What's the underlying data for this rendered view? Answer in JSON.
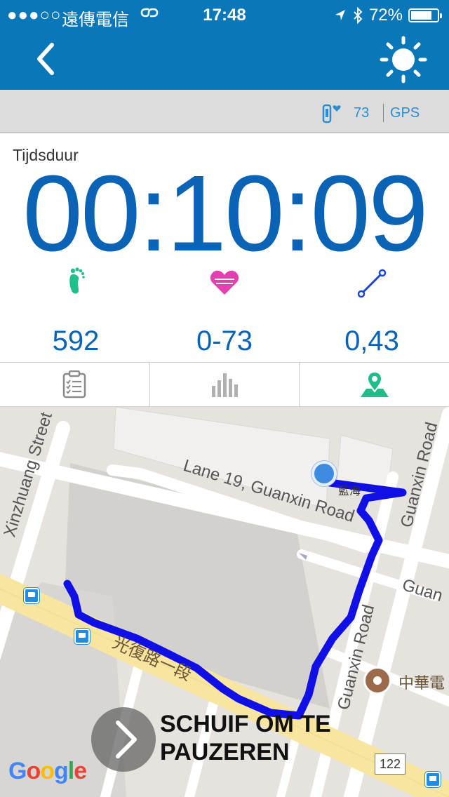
{
  "status_bar": {
    "signal": "●●●○○",
    "carrier": "遠傳電信",
    "time": "17:48",
    "battery": "72%",
    "battery_level": 0.72
  },
  "nav": {
    "back_icon": "chevron-left-icon",
    "brightness_icon": "sun-icon"
  },
  "device_bar": {
    "heart_rate": "73",
    "gps": "GPS"
  },
  "workout": {
    "duration_label": "Tijdsduur",
    "duration": "00:10:09",
    "steps": "592",
    "heart_range": "0-73",
    "distance": "0,43"
  },
  "tabs": [
    {
      "icon": "clipboard-checklist-icon",
      "active": false
    },
    {
      "icon": "bar-chart-icon",
      "active": false
    },
    {
      "icon": "map-pin-icon",
      "active": true
    }
  ],
  "map": {
    "labels": {
      "xinzhuang": "Xinzhuang Street",
      "lane19": "Lane 19, Guanxin Road",
      "guanxin_top": "Guanxin Road",
      "guanxin_mid": "Guan",
      "guanxin_road": "Guanxin Road",
      "guangfu": "光復路一段",
      "lanhai": "藍海",
      "zhonghua": "中華電"
    },
    "route_number": "122",
    "slide_text": "SCHUIF OM TE PAUZEREN",
    "google": [
      "G",
      "o",
      "o",
      "g",
      "l",
      "e"
    ]
  },
  "colors": {
    "header": "#0a77b8",
    "timer": "#0b63b6",
    "steps_icon": "#1fc08e",
    "heart_icon": "#e33fae",
    "distance_icon": "#1947d4",
    "route": "#0f0fe6",
    "active_tab": "#1fbc8c"
  }
}
